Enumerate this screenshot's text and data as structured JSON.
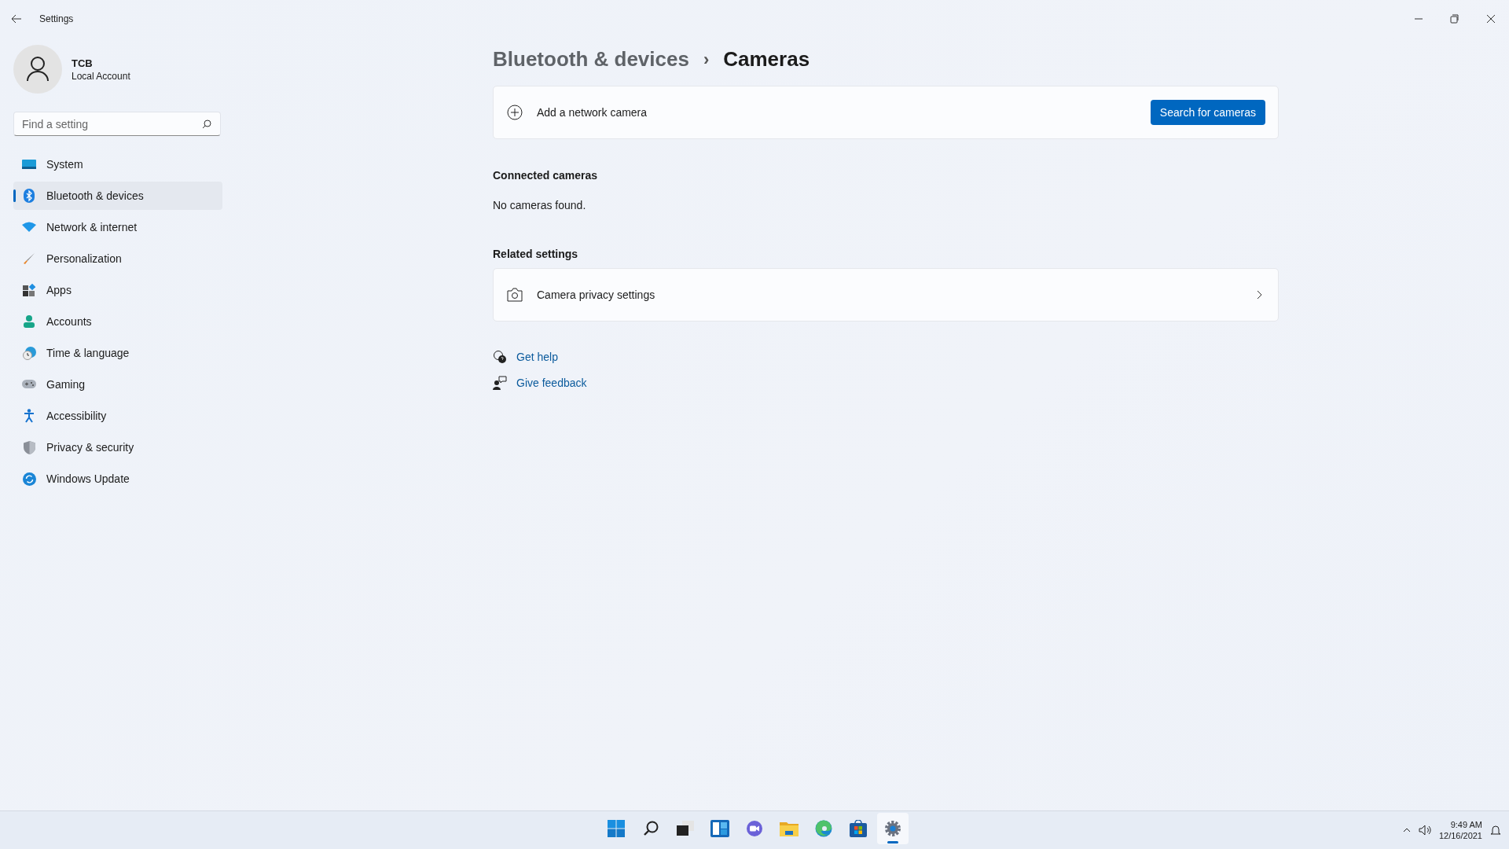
{
  "window": {
    "title": "Settings"
  },
  "account": {
    "name": "TCB",
    "type": "Local Account"
  },
  "search": {
    "placeholder": "Find a setting"
  },
  "nav": [
    {
      "label": "System",
      "kind": "system",
      "selected": false
    },
    {
      "label": "Bluetooth & devices",
      "kind": "bluetooth",
      "selected": true
    },
    {
      "label": "Network & internet",
      "kind": "network",
      "selected": false
    },
    {
      "label": "Personalization",
      "kind": "brush",
      "selected": false
    },
    {
      "label": "Apps",
      "kind": "apps",
      "selected": false
    },
    {
      "label": "Accounts",
      "kind": "accounts",
      "selected": false
    },
    {
      "label": "Time & language",
      "kind": "time",
      "selected": false
    },
    {
      "label": "Gaming",
      "kind": "gaming",
      "selected": false
    },
    {
      "label": "Accessibility",
      "kind": "accessibility",
      "selected": false
    },
    {
      "label": "Privacy & security",
      "kind": "privacy",
      "selected": false
    },
    {
      "label": "Windows Update",
      "kind": "update",
      "selected": false
    }
  ],
  "breadcrumb": {
    "parent": "Bluetooth & devices",
    "separator": "›",
    "current": "Cameras"
  },
  "add_card": {
    "label": "Add a network camera",
    "button": "Search for cameras"
  },
  "connected": {
    "heading": "Connected cameras",
    "empty": "No cameras found."
  },
  "related": {
    "heading": "Related settings",
    "items": [
      {
        "label": "Camera privacy settings"
      }
    ]
  },
  "help_links": [
    {
      "label": "Get help",
      "kind": "help"
    },
    {
      "label": "Give feedback",
      "kind": "feedback"
    }
  ],
  "taskbar": {
    "apps": [
      {
        "kind": "start",
        "selected": false
      },
      {
        "kind": "search",
        "selected": false
      },
      {
        "kind": "taskview",
        "selected": false
      },
      {
        "kind": "widgets",
        "selected": false
      },
      {
        "kind": "chat",
        "selected": false
      },
      {
        "kind": "explorer",
        "selected": false
      },
      {
        "kind": "edge",
        "selected": false
      },
      {
        "kind": "store",
        "selected": false
      },
      {
        "kind": "settings",
        "selected": true
      }
    ],
    "time": "9:49 AM",
    "date": "12/16/2021"
  }
}
